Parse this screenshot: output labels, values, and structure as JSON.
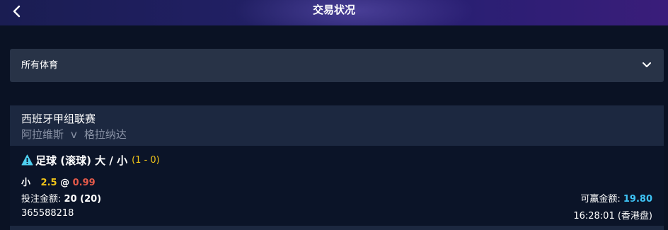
{
  "header": {
    "title": "交易状况",
    "back_icon": "chevron-left-icon"
  },
  "filter": {
    "selected": "所有体育",
    "icon": "chevron-down-icon"
  },
  "bet": {
    "league": "西班牙甲组联赛",
    "home_team": "阿拉维斯",
    "vs": "v",
    "away_team": "格拉纳达",
    "market": "足球 (滚球) 大 / 小",
    "score": "(1 - 0)",
    "selection": "小",
    "line": "2.5",
    "at": "@",
    "odds": "0.99",
    "stake_label": "投注金额:",
    "stake_value": "20 (20)",
    "win_label": "可赢金额:",
    "win_value": "19.80",
    "bet_id": "365588218",
    "time": "16:28:01 (香港盘)",
    "warning_icon": "warning-icon"
  },
  "colors": {
    "accent_yellow": "#f0c419",
    "odds_red": "#e45a4a",
    "win_blue": "#3ec3f5",
    "warning_cyan": "#4fd0f0"
  }
}
